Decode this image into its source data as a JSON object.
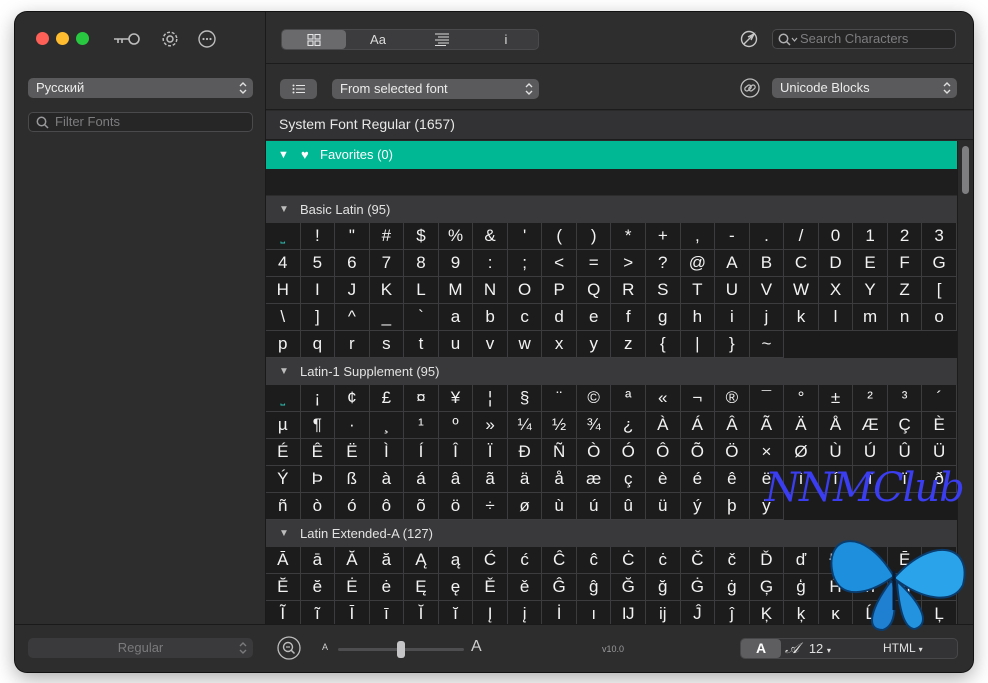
{
  "sidebar": {
    "language_select": "Русский",
    "filter_placeholder": "Filter Fonts",
    "style_select": "Regular"
  },
  "toolbar": {
    "view_tabs": [
      "grid-icon",
      "Aa",
      "glyph-info-icon",
      "i"
    ],
    "active_tab_index": 0,
    "search_placeholder": "Search Characters"
  },
  "toolbar2": {
    "source_select": "From selected font",
    "blocks_select": "Unicode Blocks"
  },
  "font_info": "System Font Regular (1657)",
  "favorites": {
    "label": "Favorites (0)"
  },
  "sections": [
    {
      "label": "Basic Latin (95)",
      "chars": [
        " ",
        "!",
        "\"",
        "#",
        "$",
        "%",
        "&",
        "'",
        "(",
        ")",
        "*",
        "+",
        ",",
        "-",
        ".",
        "/",
        "0",
        "1",
        "2",
        "3",
        "4",
        "5",
        "6",
        "7",
        "8",
        "9",
        ":",
        ";",
        "<",
        "=",
        ">",
        "?",
        "@",
        "A",
        "B",
        "C",
        "D",
        "E",
        "F",
        "G",
        "H",
        "I",
        "J",
        "K",
        "L",
        "M",
        "N",
        "O",
        "P",
        "Q",
        "R",
        "S",
        "T",
        "U",
        "V",
        "W",
        "X",
        "Y",
        "Z",
        "[",
        "\\",
        "]",
        "^",
        "_",
        "`",
        "a",
        "b",
        "c",
        "d",
        "e",
        "f",
        "g",
        "h",
        "i",
        "j",
        "k",
        "l",
        "m",
        "n",
        "o",
        "p",
        "q",
        "r",
        "s",
        "t",
        "u",
        "v",
        "w",
        "x",
        "y",
        "z",
        "{",
        "|",
        "}",
        "~"
      ]
    },
    {
      "label": "Latin-1 Supplement (95)",
      "chars": [
        " ",
        "¡",
        "¢",
        "£",
        "¤",
        "¥",
        "¦",
        "§",
        "¨",
        "©",
        "ª",
        "«",
        "¬",
        "®",
        "¯",
        "°",
        "±",
        "²",
        "³",
        "´",
        "µ",
        "¶",
        "·",
        "¸",
        "¹",
        "º",
        "»",
        "¼",
        "½",
        "¾",
        "¿",
        "À",
        "Á",
        "Â",
        "Ã",
        "Ä",
        "Å",
        "Æ",
        "Ç",
        "È",
        "É",
        "Ê",
        "Ë",
        "Ì",
        "Í",
        "Î",
        "Ï",
        "Ð",
        "Ñ",
        "Ò",
        "Ó",
        "Ô",
        "Õ",
        "Ö",
        "×",
        "Ø",
        "Ù",
        "Ú",
        "Û",
        "Ü",
        "Ý",
        "Þ",
        "ß",
        "à",
        "á",
        "â",
        "ã",
        "ä",
        "å",
        "æ",
        "ç",
        "è",
        "é",
        "ê",
        "ë",
        "ì",
        "í",
        "î",
        "ï",
        "ð",
        "ñ",
        "ò",
        "ó",
        "ô",
        "õ",
        "ö",
        "÷",
        "ø",
        "ù",
        "ú",
        "û",
        "ü",
        "ý",
        "þ",
        "ÿ"
      ]
    },
    {
      "label": "Latin Extended-A (127)",
      "chars": [
        "Ā",
        "ā",
        "Ă",
        "ă",
        "Ą",
        "ą",
        "Ć",
        "ć",
        "Ĉ",
        "ĉ",
        "Ċ",
        "ċ",
        "Č",
        "č",
        "Ď",
        "ď",
        "Đ",
        "đ",
        "Ē",
        "ē",
        "Ĕ",
        "ĕ",
        "Ė",
        "ė",
        "Ę",
        "ę",
        "Ě",
        "ě",
        "Ĝ",
        "ĝ",
        "Ğ",
        "ğ",
        "Ġ",
        "ġ",
        "Ģ",
        "ģ",
        "Ĥ",
        "ĥ",
        "Ħ",
        "ħ",
        "Ĩ",
        "ĩ",
        "Ī",
        "ī",
        "Ĭ",
        "ĭ",
        "Į",
        "į",
        "İ",
        "ı",
        "Ĳ",
        "ĳ",
        "Ĵ",
        "ĵ",
        "Ķ",
        "ķ",
        "ĸ",
        "Ĺ",
        "ĺ",
        "Ļ"
      ]
    }
  ],
  "footer": {
    "small_a": "A",
    "big_a": "A",
    "font_size_slider": 0.5,
    "version": "v10.0",
    "format_a": "A",
    "size": "12",
    "format": "HTML"
  },
  "watermark": {
    "text": "NNMClub"
  },
  "colors": {
    "accent_green": "#00b894",
    "space_marker": "#2ec4b6"
  }
}
